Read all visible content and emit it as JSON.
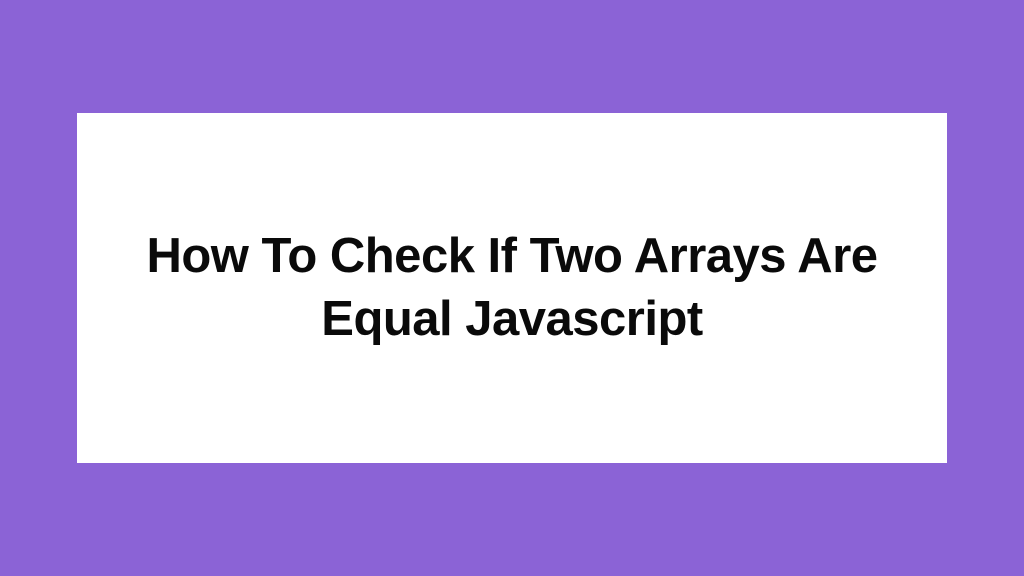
{
  "card": {
    "title": "How To Check If Two Arrays Are Equal Javascript"
  }
}
